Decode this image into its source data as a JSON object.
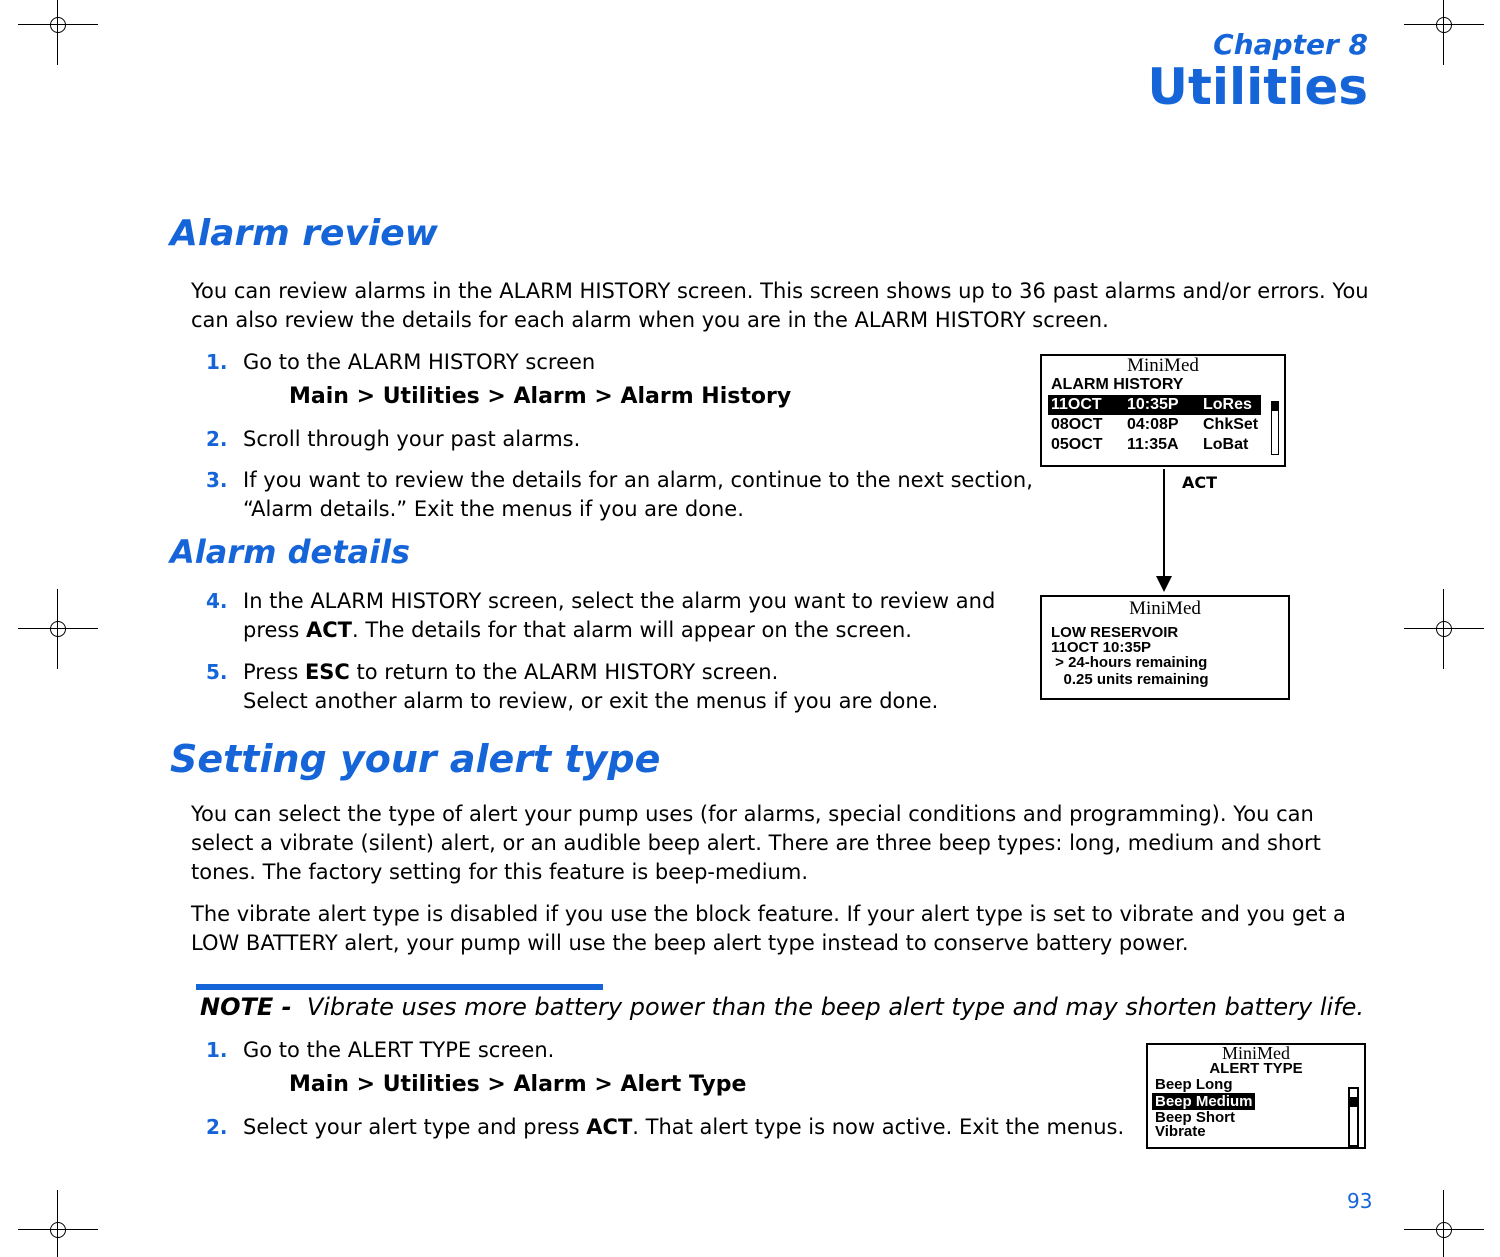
{
  "header": {
    "chapter": "Chapter 8",
    "title": "Utilities"
  },
  "alarm_review": {
    "heading": "Alarm review",
    "intro": "You can review alarms in the ALARM HISTORY screen. This screen shows up to 36 past alarms and/or errors. You can also review the details for each alarm when you are in the ALARM HISTORY screen.",
    "steps": [
      {
        "n": "1.",
        "text": "Go to the ALARM HISTORY screen"
      },
      {
        "n": "2.",
        "text": "Scroll through your past alarms."
      },
      {
        "n": "3.",
        "text": "If you want to review the details for an alarm, continue to the next section, “Alarm details.” Exit the menus if you are done."
      }
    ],
    "path": "Main > Utilities > Alarm > Alarm History"
  },
  "alarm_details": {
    "heading": "Alarm details",
    "step4": {
      "n": "4.",
      "a": "In the ALARM HISTORY screen, select the alarm you want to review and press ",
      "b": "ACT",
      "c": ". The details for that alarm will appear on the screen."
    },
    "step5": {
      "n": "5.",
      "a": "Press ",
      "b": "ESC",
      "c": " to return to the ALARM HISTORY screen.",
      "d": "Select another alarm to review, or exit the menus if you are done."
    }
  },
  "screen1": {
    "brand": "MiniMed",
    "title": "ALARM HISTORY",
    "rows": [
      [
        "11OCT",
        "10:35P",
        "LoRes"
      ],
      [
        "08OCT",
        "04:08P",
        "ChkSet"
      ],
      [
        "05OCT",
        "11:35A",
        "LoBat"
      ]
    ],
    "selected": 0
  },
  "arrow_label": "ACT",
  "screen2": {
    "brand": "MiniMed",
    "lines": [
      "LOW RESERVOIR",
      "11OCT 10:35P",
      " > 24-hours remaining",
      "   0.25 units remaining"
    ]
  },
  "alert": {
    "heading": "Setting your alert type",
    "p1": "You can select the type of alert your pump uses (for alarms, special conditions and programming). You can select a vibrate (silent) alert, or an audible beep alert. There are three beep types: long, medium and short tones. The factory setting for this feature is beep-medium.",
    "p2": "The vibrate alert type is disabled if you use the block feature. If your alert type is set to vibrate and you get a LOW BATTERY alert, your pump will use the beep alert type instead to conserve battery power.",
    "note_label": "NOTE -",
    "note": "Vibrate uses more battery power than the beep alert type and may shorten battery life.",
    "step1": {
      "n": "1.",
      "text": "Go to the ALERT TYPE screen."
    },
    "path": "Main > Utilities > Alarm > Alert Type",
    "step2": {
      "n": "2.",
      "a": "Select your alert type and press ",
      "b": "ACT",
      "c": ". That alert type is now active. Exit the menus."
    }
  },
  "screen3": {
    "brand": "MiniMed",
    "title": "ALERT TYPE",
    "items": [
      "Beep Long",
      "Beep Medium",
      "Beep Short",
      "Vibrate"
    ],
    "selected": 1
  },
  "page_number": "93",
  "colors": {
    "accent": "#1565d8"
  }
}
